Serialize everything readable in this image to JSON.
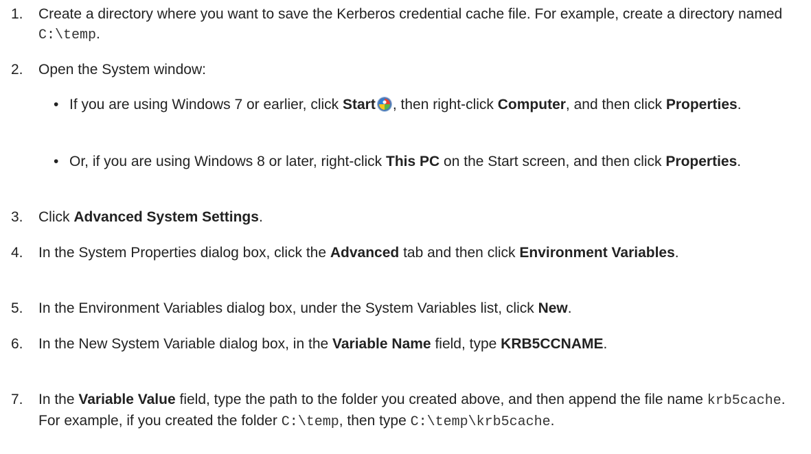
{
  "steps": [
    {
      "number": "1.",
      "parts": [
        "Create a directory where you want to save the Kerberos credential cache file. For example, create a directory named ",
        "C:\\temp",
        "."
      ]
    },
    {
      "number": "2.",
      "text": "Open the System window:",
      "bullets": [
        {
          "marker": "•",
          "parts": [
            "If you are using Windows 7 or earlier, click ",
            "Start",
            ", then right-click ",
            "Computer",
            ", and then click ",
            "Properties",
            "."
          ],
          "icon": "windows-start-orb-icon"
        },
        {
          "marker": "•",
          "parts": [
            "Or, if you are using Windows 8 or later, right-click ",
            "This PC",
            " on the Start screen, and then click ",
            "Properties",
            "."
          ]
        }
      ]
    },
    {
      "number": "3.",
      "parts": [
        "Click ",
        "Advanced System Settings",
        "."
      ]
    },
    {
      "number": "4.",
      "parts": [
        "In the System Properties dialog box, click the ",
        "Advanced",
        " tab and then click ",
        "Environment Variables",
        "."
      ]
    },
    {
      "number": "5.",
      "parts": [
        "In the Environment Variables dialog box, under the System Variables list, click ",
        "New",
        "."
      ]
    },
    {
      "number": "6.",
      "parts": [
        "In the New System Variable dialog box, in the ",
        "Variable Name",
        " field, type ",
        "KRB5CCNAME",
        "."
      ]
    },
    {
      "number": "7.",
      "parts": [
        "In the ",
        "Variable Value",
        " field, type the path to the folder you created above, and then append the file name ",
        "krb5cache",
        ". For example, if you created the folder ",
        "C:\\temp",
        ", then type ",
        "C:\\temp\\krb5cache",
        "."
      ]
    }
  ]
}
